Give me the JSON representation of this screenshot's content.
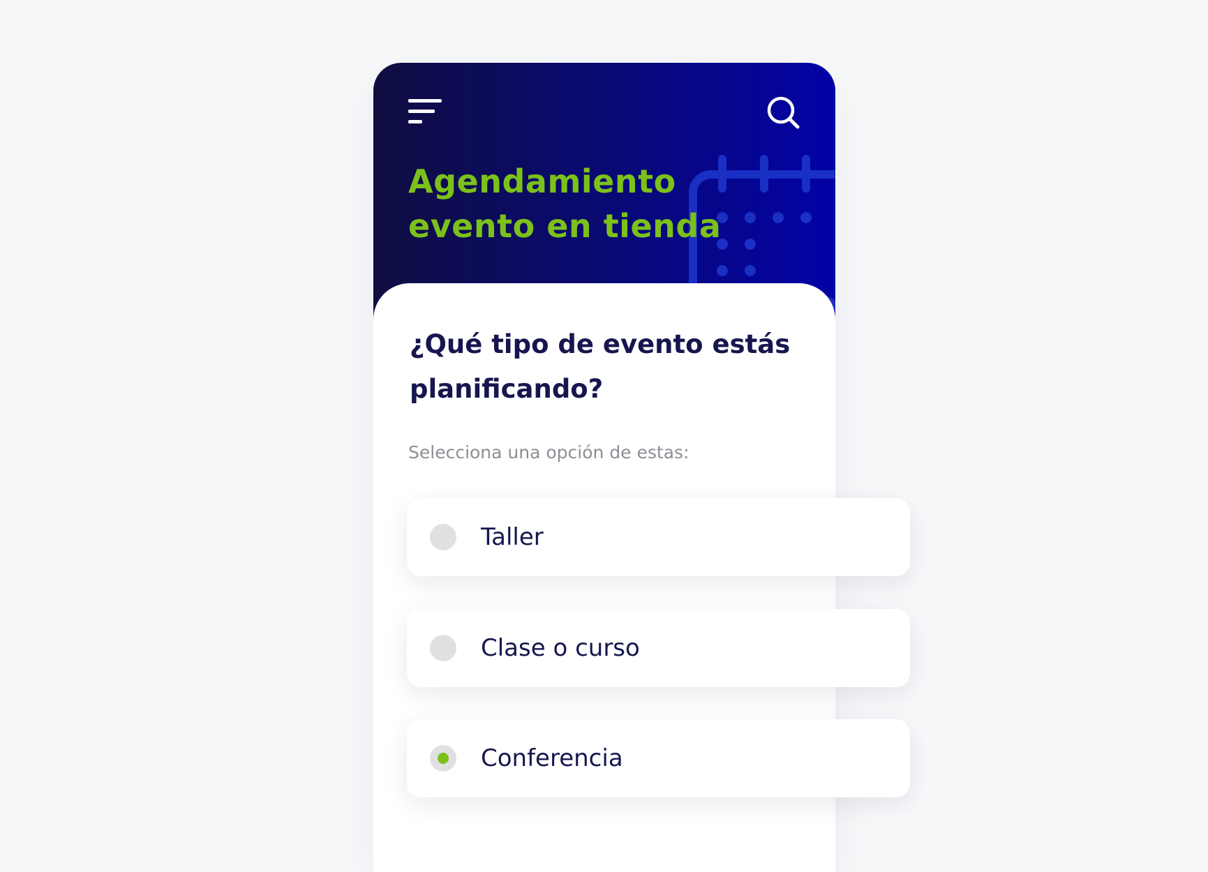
{
  "header": {
    "title_line1": "Agendamiento",
    "title_line2": "evento en tienda",
    "menu_icon": "hamburger-menu-icon",
    "search_icon": "search-icon",
    "decoration_icon": "calendar-clock-icon"
  },
  "question": {
    "line1": "¿Qué tipo de evento estás",
    "line2": "planificando?"
  },
  "helper_text": "Selecciona una opción de estas:",
  "options": [
    {
      "label": "Taller",
      "selected": false
    },
    {
      "label": "Clase o curso",
      "selected": false
    },
    {
      "label": "Conferencia",
      "selected": true
    }
  ],
  "colors": {
    "accent_green": "#7cc11a",
    "text_navy": "#16164f",
    "header_gradient_start": "#0f0d40",
    "header_gradient_end": "#0202a6",
    "helper_gray": "#8e8e96",
    "radio_unselected": "#e0e0e2"
  }
}
